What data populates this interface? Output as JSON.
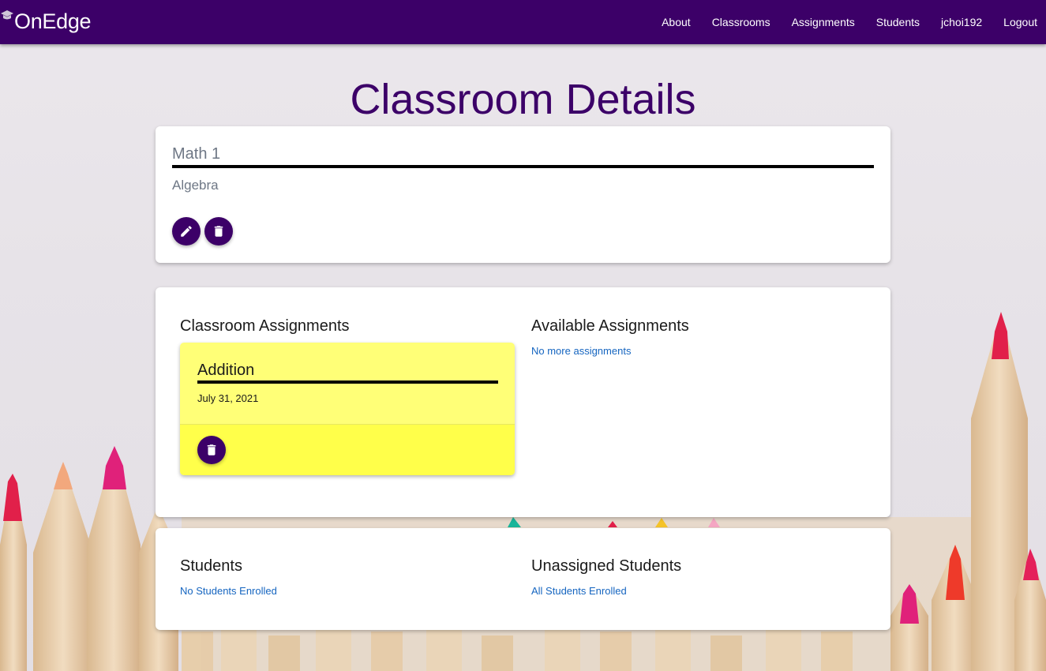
{
  "nav": {
    "brand": "OnEdge",
    "links": [
      "About",
      "Classrooms",
      "Assignments",
      "Students",
      "jchoi192",
      "Logout"
    ]
  },
  "page": {
    "title": "Classroom Details"
  },
  "classroom": {
    "name": "Math 1",
    "subject": "Algebra"
  },
  "assignments_section": {
    "classroom_title": "Classroom Assignments",
    "available_title": "Available Assignments",
    "available_empty": "No more assignments",
    "items": [
      {
        "name": "Addition",
        "date": "July 31, 2021"
      }
    ]
  },
  "students_section": {
    "students_title": "Students",
    "students_empty": "No Students Enrolled",
    "unassigned_title": "Unassigned Students",
    "unassigned_empty": "All Students Enrolled"
  },
  "colors": {
    "primary": "#3c0068",
    "assignment_card": "#ffff77",
    "link": "#1565c0"
  }
}
